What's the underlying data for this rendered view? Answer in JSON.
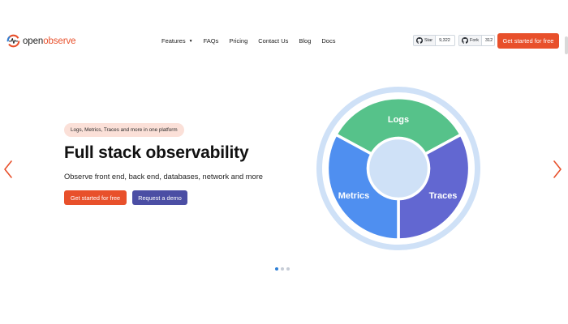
{
  "brand": {
    "name_part1": "open",
    "name_part2": "observe",
    "accent": "#e8502b",
    "logo_icon": "openobserve-logo-icon"
  },
  "nav": {
    "items": [
      {
        "label": "Features",
        "has_dropdown": true
      },
      {
        "label": "FAQs"
      },
      {
        "label": "Pricing"
      },
      {
        "label": "Contact Us"
      },
      {
        "label": "Blog"
      },
      {
        "label": "Docs"
      }
    ]
  },
  "github": {
    "star_label": "Star",
    "star_count": "9,322",
    "fork_label": "Fork",
    "fork_count": "312",
    "icon": "github-icon"
  },
  "header_cta": "Get started for free",
  "hero": {
    "pill": "Logs, Metrics, Traces and more in one platform",
    "title": "Full stack observability",
    "subtitle": "Observe front end, back end, databases, network and more",
    "primary_button": "Get started for free",
    "secondary_button": "Request a demo",
    "colors": {
      "primary": "#e8502b",
      "secondary": "#4b4ea4"
    }
  },
  "wheel": {
    "segments": [
      {
        "label": "Logs",
        "color": "#56c28a"
      },
      {
        "label": "Metrics",
        "color": "#4f8ff0"
      },
      {
        "label": "Traces",
        "color": "#6267d1"
      }
    ],
    "ring_color": "#cfe1f7"
  },
  "carousel": {
    "slides": 3,
    "active_index": 0,
    "prev_icon": "chevron-left-icon",
    "next_icon": "chevron-right-icon",
    "arrow_color": "#e8502b"
  }
}
